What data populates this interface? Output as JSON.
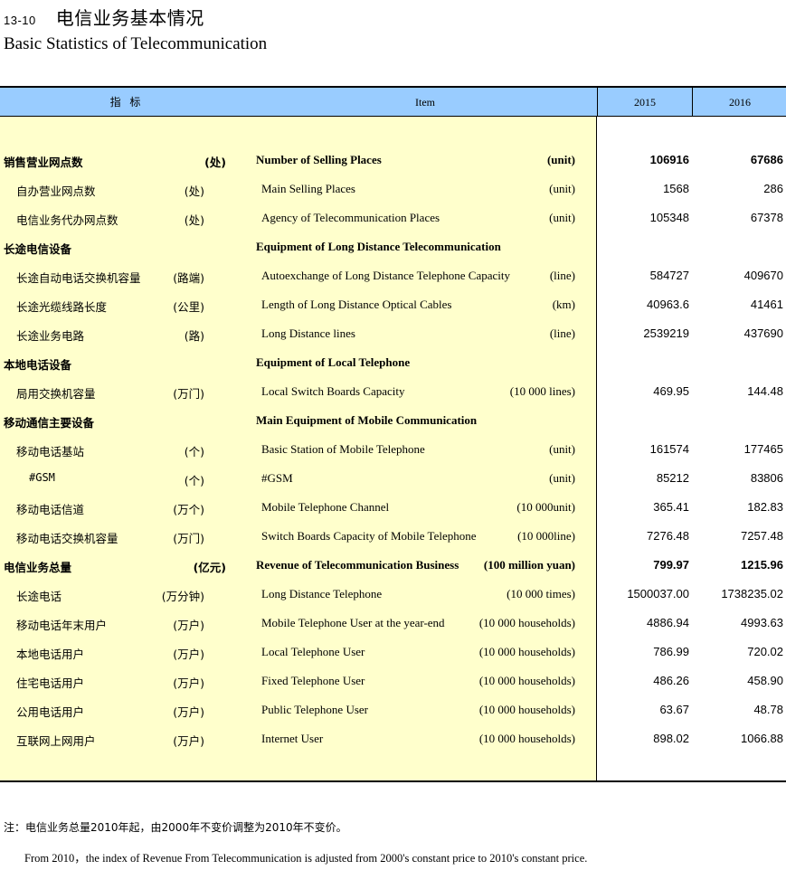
{
  "title": {
    "number": "13-10",
    "cn": "电信业务基本情况",
    "en": "Basic Statistics of Telecommunication"
  },
  "header": {
    "indicator": "指 标",
    "item": "Item",
    "year1": "2015",
    "year2": "2016"
  },
  "rows": [
    {
      "cn": "销售营业网点数",
      "cn_unit": "(处)",
      "en": "Number of Selling Places",
      "en_unit": "(unit)",
      "v2015": "106916",
      "v2016": "67686",
      "level": 0,
      "bold": true
    },
    {
      "cn": "自办营业网点数",
      "cn_unit": "(处)",
      "en": "Main Selling Places",
      "en_unit": "(unit)",
      "v2015": "1568",
      "v2016": "286",
      "level": 1
    },
    {
      "cn": "电信业务代办网点数",
      "cn_unit": "(处)",
      "en": "Agency of Telecommunication Places",
      "en_unit": "(unit)",
      "v2015": "105348",
      "v2016": "67378",
      "level": 1
    },
    {
      "cn": "长途电信设备",
      "cn_unit": "",
      "en": "Equipment of Long Distance Telecommunication",
      "en_unit": "",
      "v2015": "",
      "v2016": "",
      "level": 0,
      "bold": true
    },
    {
      "cn": "长途自动电话交换机容量",
      "cn_unit": "(路端)",
      "en": "Autoexchange of Long Distance Telephone Capacity",
      "en_unit": "(line)",
      "v2015": "584727",
      "v2016": "409670",
      "level": 1
    },
    {
      "cn": "长途光缆线路长度",
      "cn_unit": "(公里)",
      "en": "Length of Long Distance Optical Cables",
      "en_unit": "(km)",
      "v2015": "40963.6",
      "v2016": "41461",
      "level": 1
    },
    {
      "cn": "长途业务电路",
      "cn_unit": "(路)",
      "en": "Long Distance lines",
      "en_unit": "(line)",
      "v2015": "2539219",
      "v2016": "437690",
      "level": 1
    },
    {
      "cn": "本地电话设备",
      "cn_unit": "",
      "en": "Equipment of Local Telephone",
      "en_unit": "",
      "v2015": "",
      "v2016": "",
      "level": 0,
      "bold": true
    },
    {
      "cn": "局用交换机容量",
      "cn_unit": "(万门)",
      "en": "Local Switch Boards Capacity",
      "en_unit": "(10 000 lines)",
      "v2015": "469.95",
      "v2016": "144.48",
      "level": 1
    },
    {
      "cn": "移动通信主要设备",
      "cn_unit": "",
      "en": "Main Equipment of Mobile Communication",
      "en_unit": "",
      "v2015": "",
      "v2016": "",
      "level": 0,
      "bold": true
    },
    {
      "cn": "移动电话基站",
      "cn_unit": "(个)",
      "en": "Basic Station of Mobile Telephone",
      "en_unit": "(unit)",
      "v2015": "161574",
      "v2016": "177465",
      "level": 1
    },
    {
      "cn": "#GSM",
      "cn_unit": "(个)",
      "en": "#GSM",
      "en_unit": "(unit)",
      "v2015": "85212",
      "v2016": "83806",
      "level": 2
    },
    {
      "cn": "移动电话信道",
      "cn_unit": "(万个)",
      "en": "Mobile Telephone Channel",
      "en_unit": "(10 000unit)",
      "v2015": "365.41",
      "v2016": "182.83",
      "level": 1
    },
    {
      "cn": "移动电话交换机容量",
      "cn_unit": "(万门)",
      "en": "Switch Boards Capacity of Mobile Telephone",
      "en_unit": "(10 000line)",
      "v2015": "7276.48",
      "v2016": "7257.48",
      "level": 1
    },
    {
      "cn": "电信业务总量",
      "cn_unit": "(亿元)",
      "en": "Revenue of Telecommunication Business",
      "en_unit": "(100 million yuan)",
      "v2015": "799.97",
      "v2016": "1215.96",
      "level": 0,
      "bold": true
    },
    {
      "cn": "长途电话",
      "cn_unit": "(万分钟)",
      "en": "Long Distance Telephone",
      "en_unit": "(10 000 times)",
      "v2015": "1500037.00",
      "v2016": "1738235.02",
      "level": 1
    },
    {
      "cn": "移动电话年末用户",
      "cn_unit": "(万户)",
      "en": "Mobile Telephone User at the year-end",
      "en_unit": "(10 000 households)",
      "v2015": "4886.94",
      "v2016": "4993.63",
      "level": 1
    },
    {
      "cn": "本地电话用户",
      "cn_unit": "(万户)",
      "en": "Local Telephone User",
      "en_unit": "(10 000 households)",
      "v2015": "786.99",
      "v2016": "720.02",
      "level": 1
    },
    {
      "cn": "住宅电话用户",
      "cn_unit": "(万户)",
      "en": "Fixed Telephone User",
      "en_unit": "(10 000 households)",
      "v2015": "486.26",
      "v2016": "458.90",
      "level": 1
    },
    {
      "cn": "公用电话用户",
      "cn_unit": "(万户)",
      "en": "Public Telephone User",
      "en_unit": "(10 000 households)",
      "v2015": "63.67",
      "v2016": "48.78",
      "level": 1
    },
    {
      "cn": "互联网上网用户",
      "cn_unit": "(万户)",
      "en": "Internet User",
      "en_unit": "(10 000 households)",
      "v2015": "898.02",
      "v2016": "1066.88",
      "level": 1
    }
  ],
  "notes": {
    "cn": "注：电信业务总量2010年起，由2000年不变价调整为2010年不变价。",
    "en": "From 2010，the index of Revenue From Telecommunication is adjusted from 2000's constant price to 2010's constant price."
  }
}
